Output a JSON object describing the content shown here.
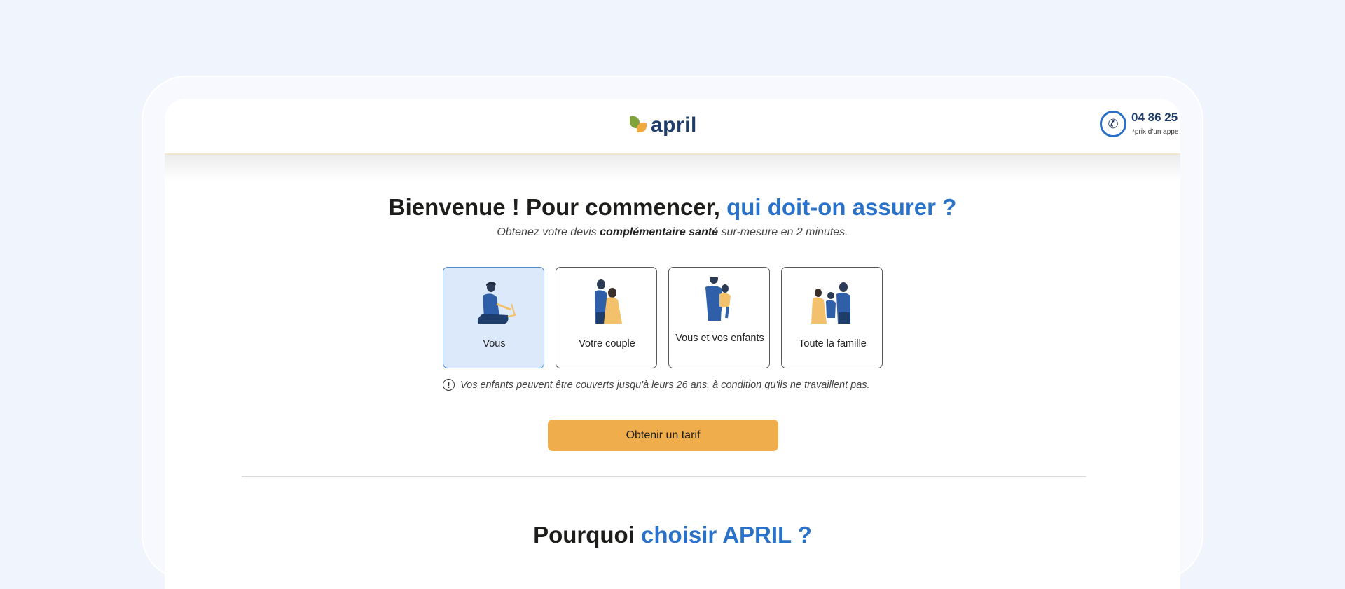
{
  "header": {
    "logo_text": "april",
    "phone_number": "04 86 25",
    "phone_note": "*prix d'un appe",
    "phone_icon": "phone-icon"
  },
  "hero": {
    "title_main": "Bienvenue ! Pour commencer, ",
    "title_accent": "qui doit-on assurer ?",
    "subtitle_before": "Obtenez votre devis ",
    "subtitle_bold": "complémentaire santé",
    "subtitle_after": " sur-mesure en 2 minutes."
  },
  "options": [
    {
      "label": "Vous",
      "selected": true,
      "illustration": "person-with-laptop"
    },
    {
      "label": "Votre couple",
      "selected": false,
      "illustration": "couple"
    },
    {
      "label": "Vous et vos enfants",
      "selected": false,
      "illustration": "parent-with-child"
    },
    {
      "label": "Toute la famille",
      "selected": false,
      "illustration": "family"
    }
  ],
  "info": {
    "icon": "exclamation-circle-icon",
    "text": "Vos enfants peuvent être couverts jusqu'à leurs 26 ans, à condition qu'ils ne travaillent pas."
  },
  "cta": {
    "label": "Obtenir un tarif"
  },
  "section": {
    "title_main": "Pourquoi ",
    "title_accent": "choisir APRIL ?"
  },
  "colors": {
    "accent_blue": "#2a72c9",
    "navy": "#1f3d6b",
    "cta_orange": "#efad4b",
    "selected_bg": "#dce9fb",
    "page_bg": "#f0f5fd"
  }
}
